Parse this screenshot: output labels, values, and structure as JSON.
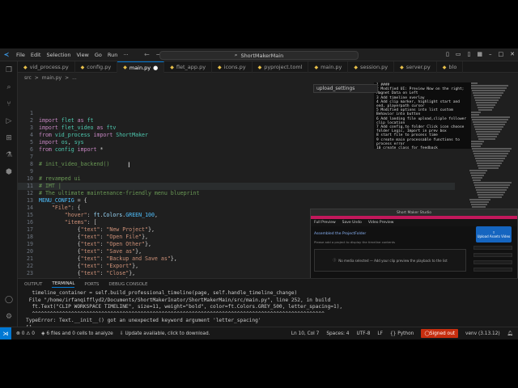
{
  "window": {
    "title": "ShortMakerMain",
    "menu": [
      "File",
      "Edit",
      "Selection",
      "View",
      "Go",
      "Run",
      "···"
    ]
  },
  "tabs": [
    {
      "label": "vid_process.py",
      "active": false
    },
    {
      "label": "config.py",
      "active": false
    },
    {
      "label": "main.py",
      "active": true,
      "modified": true
    },
    {
      "label": "flet_app.py",
      "active": false
    },
    {
      "label": "icons.py",
      "active": false
    },
    {
      "label": "pyproject.toml",
      "active": false
    },
    {
      "label": "main.py",
      "active": false
    },
    {
      "label": "session.py",
      "active": false
    },
    {
      "label": "server.py",
      "active": false
    },
    {
      "label": "blo",
      "active": false
    }
  ],
  "breadcrumb": [
    "src",
    ">",
    "main.py",
    ">",
    "..."
  ],
  "hint_box": "upload_settings",
  "editor": {
    "lines": [
      {
        "n": "1",
        "html": ""
      },
      {
        "n": "2",
        "segments": [
          [
            "kw",
            "import "
          ],
          [
            "mod",
            "flet"
          ],
          [
            "kw",
            " as "
          ],
          [
            "mod",
            "ft"
          ]
        ]
      },
      {
        "n": "3",
        "segments": [
          [
            "kw",
            "import "
          ],
          [
            "mod",
            "flet_video"
          ],
          [
            "kw",
            " as "
          ],
          [
            "mod",
            "ftv"
          ]
        ]
      },
      {
        "n": "4",
        "segments": [
          [
            "kw",
            "from "
          ],
          [
            "mod",
            "vid_process"
          ],
          [
            "kw",
            " import "
          ],
          [
            "mod",
            "ShortMaker"
          ]
        ]
      },
      {
        "n": "5",
        "segments": [
          [
            "kw",
            "import "
          ],
          [
            "mod",
            "os"
          ],
          [
            "code",
            ", "
          ],
          [
            "mod",
            "sys"
          ]
        ]
      },
      {
        "n": "6",
        "segments": [
          [
            "kw",
            "from "
          ],
          [
            "mod",
            "config"
          ],
          [
            "kw",
            " import "
          ],
          [
            "code",
            "*"
          ]
        ]
      },
      {
        "n": "7",
        "segments": []
      },
      {
        "n": "8",
        "segments": [
          [
            "cm",
            "# init_video_backend()"
          ]
        ]
      },
      {
        "n": "9",
        "segments": []
      },
      {
        "n": "10",
        "segments": [
          [
            "cm",
            "# revamped ui"
          ]
        ]
      },
      {
        "n": "11",
        "segments": [
          [
            "cm",
            "# IMT |"
          ]
        ],
        "cursor": true
      },
      {
        "n": "12",
        "segments": [
          [
            "cm",
            "# The ultimate maintenance-friendly menu blueprint"
          ]
        ]
      },
      {
        "n": "13",
        "segments": [
          [
            "cst",
            "MENU_CONFIG"
          ],
          [
            "code",
            " = {"
          ]
        ]
      },
      {
        "n": "14",
        "segments": [
          [
            "code",
            "    "
          ],
          [
            "str",
            "\"File\""
          ],
          [
            "code",
            ": {"
          ]
        ]
      },
      {
        "n": "15",
        "segments": [
          [
            "code",
            "        "
          ],
          [
            "str",
            "\"hover\""
          ],
          [
            "code",
            ": "
          ],
          [
            "var",
            "ft"
          ],
          [
            "code",
            "."
          ],
          [
            "var",
            "Colors"
          ],
          [
            "code",
            "."
          ],
          [
            "cst",
            "GREEN_100"
          ],
          [
            "code",
            ","
          ]
        ]
      },
      {
        "n": "16",
        "segments": [
          [
            "code",
            "        "
          ],
          [
            "str",
            "\"items\""
          ],
          [
            "code",
            ": ["
          ]
        ]
      },
      {
        "n": "17",
        "segments": [
          [
            "code",
            "            {"
          ],
          [
            "str",
            "\"text\""
          ],
          [
            "code",
            ": "
          ],
          [
            "str",
            "\"New Project\""
          ],
          [
            "code",
            "},"
          ]
        ]
      },
      {
        "n": "18",
        "segments": [
          [
            "code",
            "            {"
          ],
          [
            "str",
            "\"text\""
          ],
          [
            "code",
            ": "
          ],
          [
            "str",
            "\"Open File\""
          ],
          [
            "code",
            "},"
          ]
        ]
      },
      {
        "n": "19",
        "segments": [
          [
            "code",
            "            {"
          ],
          [
            "str",
            "\"text\""
          ],
          [
            "code",
            ": "
          ],
          [
            "str",
            "\"Open Other\""
          ],
          [
            "code",
            "},"
          ]
        ]
      },
      {
        "n": "20",
        "segments": [
          [
            "code",
            "            {"
          ],
          [
            "str",
            "\"text\""
          ],
          [
            "code",
            ": "
          ],
          [
            "str",
            "\"Save as\""
          ],
          [
            "code",
            "},"
          ]
        ]
      },
      {
        "n": "21",
        "segments": [
          [
            "code",
            "            {"
          ],
          [
            "str",
            "\"text\""
          ],
          [
            "code",
            ": "
          ],
          [
            "str",
            "\"Backup and Save as\""
          ],
          [
            "code",
            "},"
          ]
        ]
      },
      {
        "n": "22",
        "segments": [
          [
            "code",
            "            {"
          ],
          [
            "str",
            "\"text\""
          ],
          [
            "code",
            ": "
          ],
          [
            "str",
            "\"Export\""
          ],
          [
            "code",
            "},"
          ]
        ]
      },
      {
        "n": "23",
        "segments": [
          [
            "code",
            "            {"
          ],
          [
            "str",
            "\"text\""
          ],
          [
            "code",
            ": "
          ],
          [
            "str",
            "\"Close\""
          ],
          [
            "code",
            "},"
          ]
        ]
      },
      {
        "n": "24",
        "segments": [
          [
            "code",
            "            {"
          ],
          [
            "str",
            "\"text\""
          ],
          [
            "code",
            ": "
          ],
          [
            "str",
            "\"Exit\""
          ],
          [
            "code",
            "},"
          ]
        ]
      },
      {
        "n": "25",
        "segments": [
          [
            "code",
            "        ]"
          ]
        ]
      },
      {
        "n": "26",
        "segments": [
          [
            "code",
            "    },"
          ]
        ]
      }
    ]
  },
  "overlay_text": [
    "1 ####",
    "2 Modified UI: Preview Now on the right; Magnet Data on Left",
    "3 Add timeline overlay",
    "4 Add clip marker, highlight start and end, playerpath cursor",
    "5 Modified options into list custom Behavior into button",
    "6 Add landing file upload,cliple follower clip location",
    "7 Add config,to folder Click icon choose folder Logic, Import in prev box",
    "8 start file to process time",
    "9 create main processable functions to process error",
    "10 create class for feedback",
    "11 add events manager",
    "12 fix overview schema Reconsidered",
    "13 fix key video playback",
    "14 industrial into sections app"
  ],
  "app_preview": {
    "title": "Short Maker Studio",
    "nav": [
      "Full Preview",
      "Save Undo",
      "Video Preview"
    ],
    "heading": "Assembled the ProjectFolder",
    "sub": "Please add a project to display the timeline contents",
    "panel_text": "No media selected — Add your clip preview the playback to the list",
    "upload_label": "Upload Assets Video"
  },
  "panel": {
    "tabs": [
      "OUTPUT",
      "TERMINAL",
      "PORTS",
      "DEBUG CONSOLE"
    ],
    "active_tab": "TERMINAL",
    "terminal": [
      "  timeline_container = self.build_professional_timeline(page, self.handle_timeline_change)",
      " File \"/home/irfanqifflyd2/Documents/ShortMakerInator/ShortMakerMain/src/main.py\", line 252, in build",
      "  ft.Text(\"CLIP WORKSPACE TIMELINE\", size=11, weight=\"bold\", color=ft.Colors.GREY_500, letter_spacing=1),",
      "  ^^^^^^^^^^^^^^^^^^^^^^^^^^^^^^^^^^^^^^^^^^^^^^^^^^^^^^^^^^^^^^^^^^^^^^^^^^^^^^^^^^^^^^^^^^^^^^^^^",
      "TypeError: Text.__init__() got an unexpected keyword argument 'letter_spacing'",
      "[]"
    ]
  },
  "statusbar": {
    "problems_errors": "0",
    "problems_warnings": "0",
    "analysis": "6 files and 0 cells to analyze",
    "update": "Update available, click to download.",
    "position": "Ln 10, Col 7",
    "spaces": "Spaces: 4",
    "encoding": "UTF-8",
    "eol": "LF",
    "language": "Python",
    "signed_out": "Signed out",
    "venv": "venv (3.13.12)"
  },
  "colors": {
    "accent": "#0078d4",
    "signed_out": "#c72e0f",
    "app_accent": "#c2185b"
  }
}
